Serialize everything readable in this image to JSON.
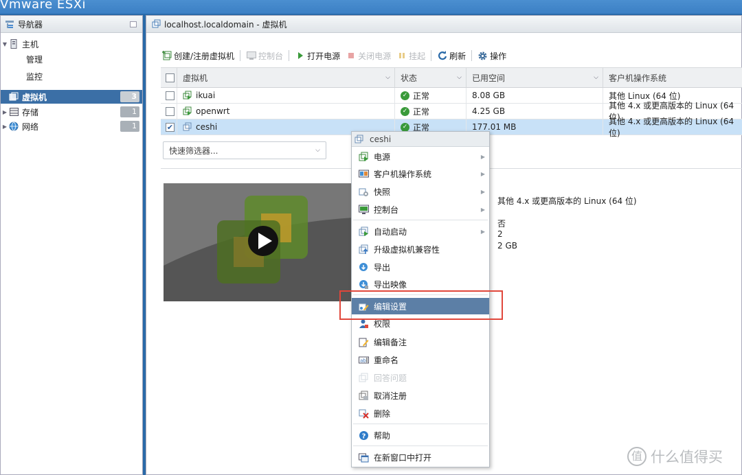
{
  "app": {
    "brand_prefix": "Vm",
    "brand_suffix": "ware ESXi"
  },
  "navigator": {
    "title": "导航器",
    "items": [
      {
        "label": "主机"
      },
      {
        "label": "管理"
      },
      {
        "label": "监控"
      },
      {
        "label": "虚拟机",
        "count": "3"
      },
      {
        "label": "存储",
        "count": "1"
      },
      {
        "label": "网络",
        "count": "1"
      }
    ]
  },
  "main": {
    "title": "localhost.localdomain - 虚拟机",
    "toolbar": {
      "create": "创建/注册虚拟机",
      "console": "控制台",
      "power_on": "打开电源",
      "power_off": "关闭电源",
      "suspend": "挂起",
      "refresh": "刷新",
      "actions": "操作"
    },
    "columns": [
      "虚拟机",
      "状态",
      "已用空间",
      "客户机操作系统"
    ],
    "rows": [
      {
        "name": "ikuai",
        "status": "正常",
        "used": "8.08 GB",
        "os": "其他 Linux (64 位)",
        "checked": false
      },
      {
        "name": "openwrt",
        "status": "正常",
        "used": "4.25 GB",
        "os": "其他 4.x 或更高版本的 Linux (64 位)",
        "checked": false
      },
      {
        "name": "ceshi",
        "status": "正常",
        "used": "177.01 MB",
        "os": "其他 4.x 或更高版本的 Linux (64 位)",
        "checked": true
      }
    ],
    "filter_placeholder": "快速筛选器...",
    "details": {
      "os": "其他 4.x 或更高版本的 Linux (64 位)",
      "v1": "否",
      "v2": "2",
      "v3": "2 GB"
    }
  },
  "context_menu": {
    "title": "ceshi",
    "items": [
      {
        "label": "电源",
        "submenu": true
      },
      {
        "label": "客户机操作系统",
        "submenu": true
      },
      {
        "label": "快照",
        "submenu": true
      },
      {
        "label": "控制台",
        "submenu": true
      },
      {
        "label": "自动启动",
        "submenu": true
      },
      {
        "label": "升级虚拟机兼容性"
      },
      {
        "label": "导出"
      },
      {
        "label": "导出映像"
      },
      {
        "label": "编辑设置",
        "highlighted": true
      },
      {
        "label": "权限"
      },
      {
        "label": "编辑备注"
      },
      {
        "label": "重命名"
      },
      {
        "label": "回答问题",
        "disabled": true
      },
      {
        "label": "取消注册"
      },
      {
        "label": "删除"
      },
      {
        "label": "帮助"
      },
      {
        "label": "在新窗口中打开"
      }
    ]
  },
  "watermark": {
    "text": "什么值得买",
    "glyph": "值"
  },
  "colors": {
    "accent": "#3b6fa6",
    "highlight": "#5c7fa6",
    "annotation": "#e0463a",
    "status_ok": "#3a9a3a"
  }
}
